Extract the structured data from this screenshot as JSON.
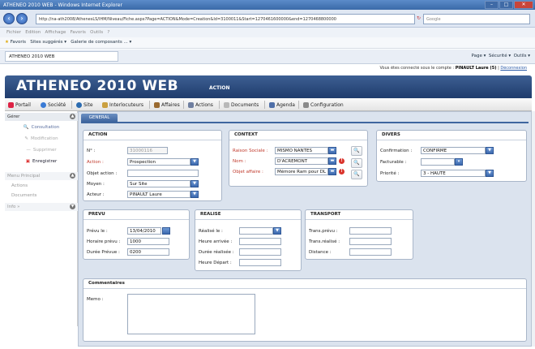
{
  "browser": {
    "title": "ATHENEO 2010 WEB - Windows Internet Explorer",
    "url": "http://na-ath2008/AthenesLS/IHM/Niveau/Fiche.aspx?Page=ACTION&Mode=Creation&Id=3100011&Start=1270461600000&end=1270468800000",
    "search_placeholder": "Google",
    "menu": [
      "Fichier",
      "Edition",
      "Affichage",
      "Favoris",
      "Outils",
      "?"
    ],
    "favorites_label": "Favoris",
    "fav_items": [
      "Sites suggérés ▾",
      "Galerie de composants ... ▾"
    ],
    "tab_label": "ATHENEO 2010 WEB",
    "toolbar_items": [
      "Page ▾",
      "Sécurité ▾",
      "Outils ▾"
    ]
  },
  "session": {
    "prefix": "Vous êtes connecté sous le compte :",
    "user": "PINAULT Laure (5)",
    "logout": "Déconnexion"
  },
  "app": {
    "brand": "ATHENEO 2010 WEB",
    "section": "ACTION",
    "nav": [
      "Portail",
      "Société",
      "Site",
      "Interlocuteurs",
      "Affaires",
      "Actions",
      "Documents",
      "Agenda",
      "Configuration"
    ]
  },
  "sidebar": {
    "gerer": "Gérer",
    "items": [
      {
        "label": "Consultation",
        "enabled": true
      },
      {
        "label": "Modification",
        "enabled": false
      },
      {
        "label": "Supprimer",
        "enabled": false
      },
      {
        "label": "Enregistrer",
        "enabled": true
      }
    ],
    "menu_principal": "Menu Principal",
    "menu_links": [
      "Actions",
      "Documents"
    ],
    "info": "Info »"
  },
  "tab": "GENERAL",
  "action": {
    "header": "ACTION",
    "no_label": "N° :",
    "no_value": "31000116",
    "action_label": "Action :",
    "action_value": "Prospection",
    "objet_label": "Objet action :",
    "objet_value": "",
    "moyen_label": "Moyen :",
    "moyen_value": "Sur Site",
    "acteur_label": "Acteur :",
    "acteur_value": "PINAULT Laure"
  },
  "context": {
    "header": "CONTEXT",
    "raison_label": "Raison Sociale :",
    "raison_value": "MISMO NANTES",
    "nom_label": "Nom :",
    "nom_value": "D'ACREMONT",
    "objet_label": "Objet affaire :",
    "objet_value": "Mémore Ram pour DL"
  },
  "divers": {
    "header": "DIVERS",
    "confirmation_label": "Confirmation :",
    "confirmation_value": "CONFIRME",
    "facturable_label": "Facturable :",
    "facturable_value": "",
    "priorite_label": "Priorité :",
    "priorite_value": "3 - HAUTE"
  },
  "prevu": {
    "header": "PREVU",
    "date_label": "Prévu le :",
    "date_value": "13/04/2010",
    "heure_label": "Horaire prévu :",
    "heure_value": "1000",
    "duree_label": "Durée Prévue :",
    "duree_value": "0200"
  },
  "realise": {
    "header": "REALISE",
    "date_label": "Réalisé le :",
    "arrivee_label": "Heure arrivée :",
    "duree_label": "Durée réalisée :",
    "depart_label": "Heure Départ :"
  },
  "transport": {
    "header": "TRANSPORT",
    "prevu_label": "Trans.prévu :",
    "realise_label": "Trans.réalisé :",
    "distance_label": "Distance :"
  },
  "commentaires": {
    "header": "Commentaires",
    "memo_label": "Memo :"
  }
}
